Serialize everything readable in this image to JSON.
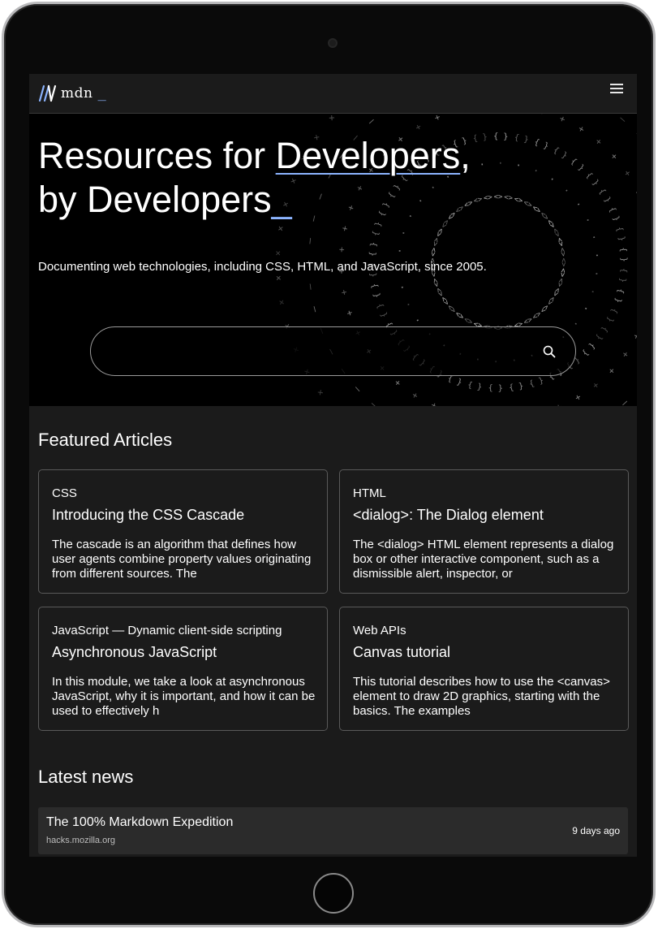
{
  "header": {
    "logo_text": "mdn",
    "logo_cursor": "_",
    "menu_icon": "hamburger-menu-icon"
  },
  "hero": {
    "title_line1_prefix": "Resources for ",
    "title_line1_link": "Developers",
    "title_line1_suffix": ",",
    "title_line2": "by Developers",
    "title_cursor": "_",
    "subtitle": "Documenting web technologies, including CSS, HTML, and JavaScript, since 2005.",
    "search": {
      "value": "",
      "placeholder": "",
      "icon": "search-icon"
    }
  },
  "featured": {
    "heading": "Featured Articles",
    "articles": [
      {
        "category": "CSS",
        "title": "Introducing the CSS Cascade",
        "description": "The cascade is an algorithm that defines how user agents combine property values originating from different sources. The"
      },
      {
        "category": "HTML",
        "title": "<dialog>: The Dialog element",
        "description": "The <dialog> HTML element represents a dialog box or other interactive component, such as a dismissible alert, inspector, or"
      },
      {
        "category": "JavaScript — Dynamic client-side scripting",
        "title": "Asynchronous JavaScript",
        "description": "In this module, we take a look at asynchronous JavaScript, why it is important, and how it can be used to effectively h"
      },
      {
        "category": "Web APIs",
        "title": "Canvas tutorial",
        "description": "This tutorial describes how to use the <canvas> element to draw 2D graphics, starting with the basics. The examples"
      }
    ]
  },
  "news": {
    "heading": "Latest news",
    "items": [
      {
        "title": "The 100% Markdown Expedition",
        "source": "hacks.mozilla.org",
        "time": "9 days ago"
      }
    ]
  },
  "colors": {
    "accent": "#8cb4ff",
    "background": "#1b1b1b",
    "hero_background": "#000000",
    "card_border": "#5a5a5a"
  }
}
